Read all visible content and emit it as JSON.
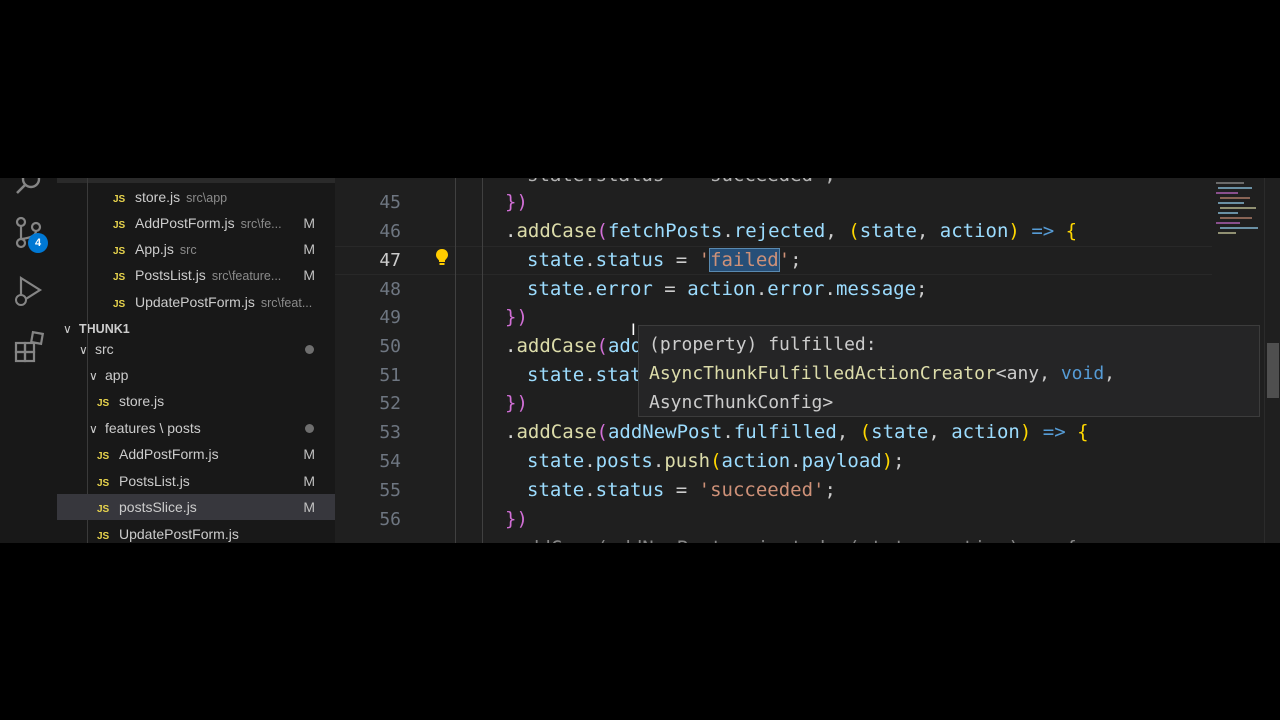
{
  "activity_bar": {
    "scm_badge": "4"
  },
  "explorer": {
    "open_editors": [
      {
        "name": "store.js",
        "path": "src\\app",
        "status": ""
      },
      {
        "name": "AddPostForm.js",
        "path": "src\\fe...",
        "status": "M"
      },
      {
        "name": "App.js",
        "path": "src",
        "status": "M"
      },
      {
        "name": "PostsList.js",
        "path": "src\\feature...",
        "status": "M"
      },
      {
        "name": "UpdatePostForm.js",
        "path": "src\\feat...",
        "status": ""
      }
    ],
    "workspace_name": "THUNK1",
    "tree": {
      "src": "src",
      "app": "app",
      "store": "store.js",
      "features": "features \\ posts",
      "files": [
        {
          "name": "AddPostForm.js",
          "status": "M"
        },
        {
          "name": "PostsList.js",
          "status": "M"
        },
        {
          "name": "postsSlice.js",
          "status": "M"
        },
        {
          "name": "UpdatePostForm.js",
          "status": ""
        }
      ]
    }
  },
  "editor": {
    "line_numbers": [
      "45",
      "46",
      "47",
      "48",
      "49",
      "50",
      "51",
      "52",
      "53",
      "54",
      "55",
      "56"
    ],
    "active_line": "47",
    "hover": {
      "line1": "(property) fulfilled:",
      "line2_type": "AsyncThunkFulfilledActionCreator",
      "line2_args": "<any, ",
      "line2_kw": "void",
      "line2_end": ",",
      "line3": "AsyncThunkConfig>"
    }
  },
  "colors": {
    "accent": "#0078d4",
    "keyword": "#569cd6",
    "string": "#ce9178",
    "function": "#dcdcaa",
    "variable": "#9cdcfe",
    "bracket_purple": "#d16fd6",
    "bracket_gold": "#ffd700"
  },
  "icons": [
    "search-icon",
    "source-control-icon",
    "run-debug-icon",
    "extensions-icon",
    "lightbulb-icon",
    "js-file-icon"
  ]
}
